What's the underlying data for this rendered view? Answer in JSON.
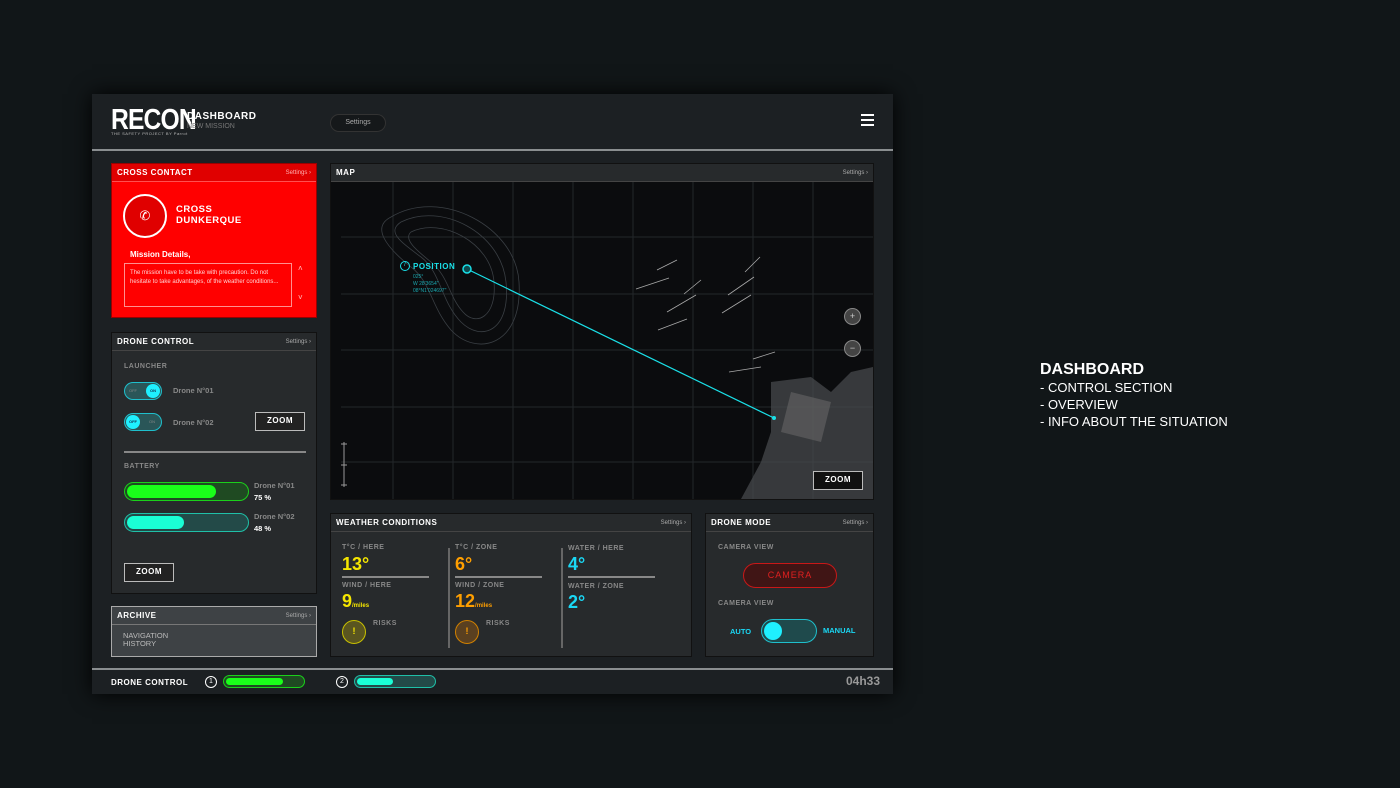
{
  "header": {
    "logo": "RECON",
    "logo_sub": "THE SAFETY PROJECT BY Parrot",
    "title": "DASHBOARD",
    "subtitle": "NEW MISSION",
    "settings": "Settings"
  },
  "cross_contact": {
    "title": "CROSS CONTACT",
    "settings": "Settings ›",
    "name_line1": "CROSS",
    "name_line2": "DUNKERQUE",
    "details_label": "Mission Details,",
    "details_text": "The mission have to be take with precaution. Do not hesitate to take advantages, of the weather conditions..."
  },
  "drone_control": {
    "title": "DRONE CONTROL",
    "settings": "Settings ›",
    "launcher_label": "LAUNCHER",
    "drone1": "Drone N°01",
    "drone2": "Drone N°02",
    "toggle_off": "OFF",
    "toggle_on": "ON",
    "zoom": "ZOOM",
    "battery_label": "BATTERY",
    "battery1_pct": "75 %",
    "battery2_pct": "48 %",
    "battery1": 0.75,
    "battery2": 0.48,
    "zoom2": "ZOOM"
  },
  "archive": {
    "title": "ARCHIVE",
    "settings": "Settings ›",
    "item_line1": "NAVIGATION",
    "item_line2": "HISTORY"
  },
  "map": {
    "title": "MAP",
    "settings": "Settings ›",
    "position_label": "POSITION",
    "coord1": "025°",
    "coord2": "W 28'3654\"",
    "coord3": "08°N1'024697\"",
    "zoom": "ZOOM"
  },
  "weather": {
    "title": "WEATHER CONDITIONS",
    "settings": "Settings ›",
    "t_here_label": "T°C / HERE",
    "t_here": "13°",
    "wind_here_label": "WIND / HERE",
    "wind_here": "9",
    "wind_unit": "/miles",
    "risks": "RISKS",
    "t_zone_label": "T°C / ZONE",
    "t_zone": "6°",
    "wind_zone_label": "WIND / ZONE",
    "wind_zone": "12",
    "water_here_label": "WATER / HERE",
    "water_here": "4°",
    "water_zone_label": "WATER / ZONE",
    "water_zone": "2°",
    "risk_icon": "!"
  },
  "drone_mode": {
    "title": "DRONE MODE",
    "settings": "Settings ›",
    "camera_view_label": "CAMERA VIEW",
    "camera_button": "CAMERA",
    "camera_view_label2": "CAMERA VIEW",
    "auto": "AUTO",
    "manual": "MANUAL"
  },
  "footer": {
    "title": "DRONE CONTROL",
    "drone1_num": "1",
    "drone2_num": "2",
    "drone1_level": 0.75,
    "drone2_level": 0.48,
    "time": "04h33"
  },
  "side_note": {
    "title": "DASHBOARD",
    "items": [
      "- CONTROL SECTION",
      "- OVERVIEW",
      "- INFO ABOUT THE SITUATION"
    ]
  },
  "colors": {
    "red": "#ff0000",
    "cyan": "#1ff0ff",
    "green": "#1aff1a",
    "teal": "#1affd5",
    "yellow": "#f5e600",
    "orange": "#ff9f00"
  }
}
